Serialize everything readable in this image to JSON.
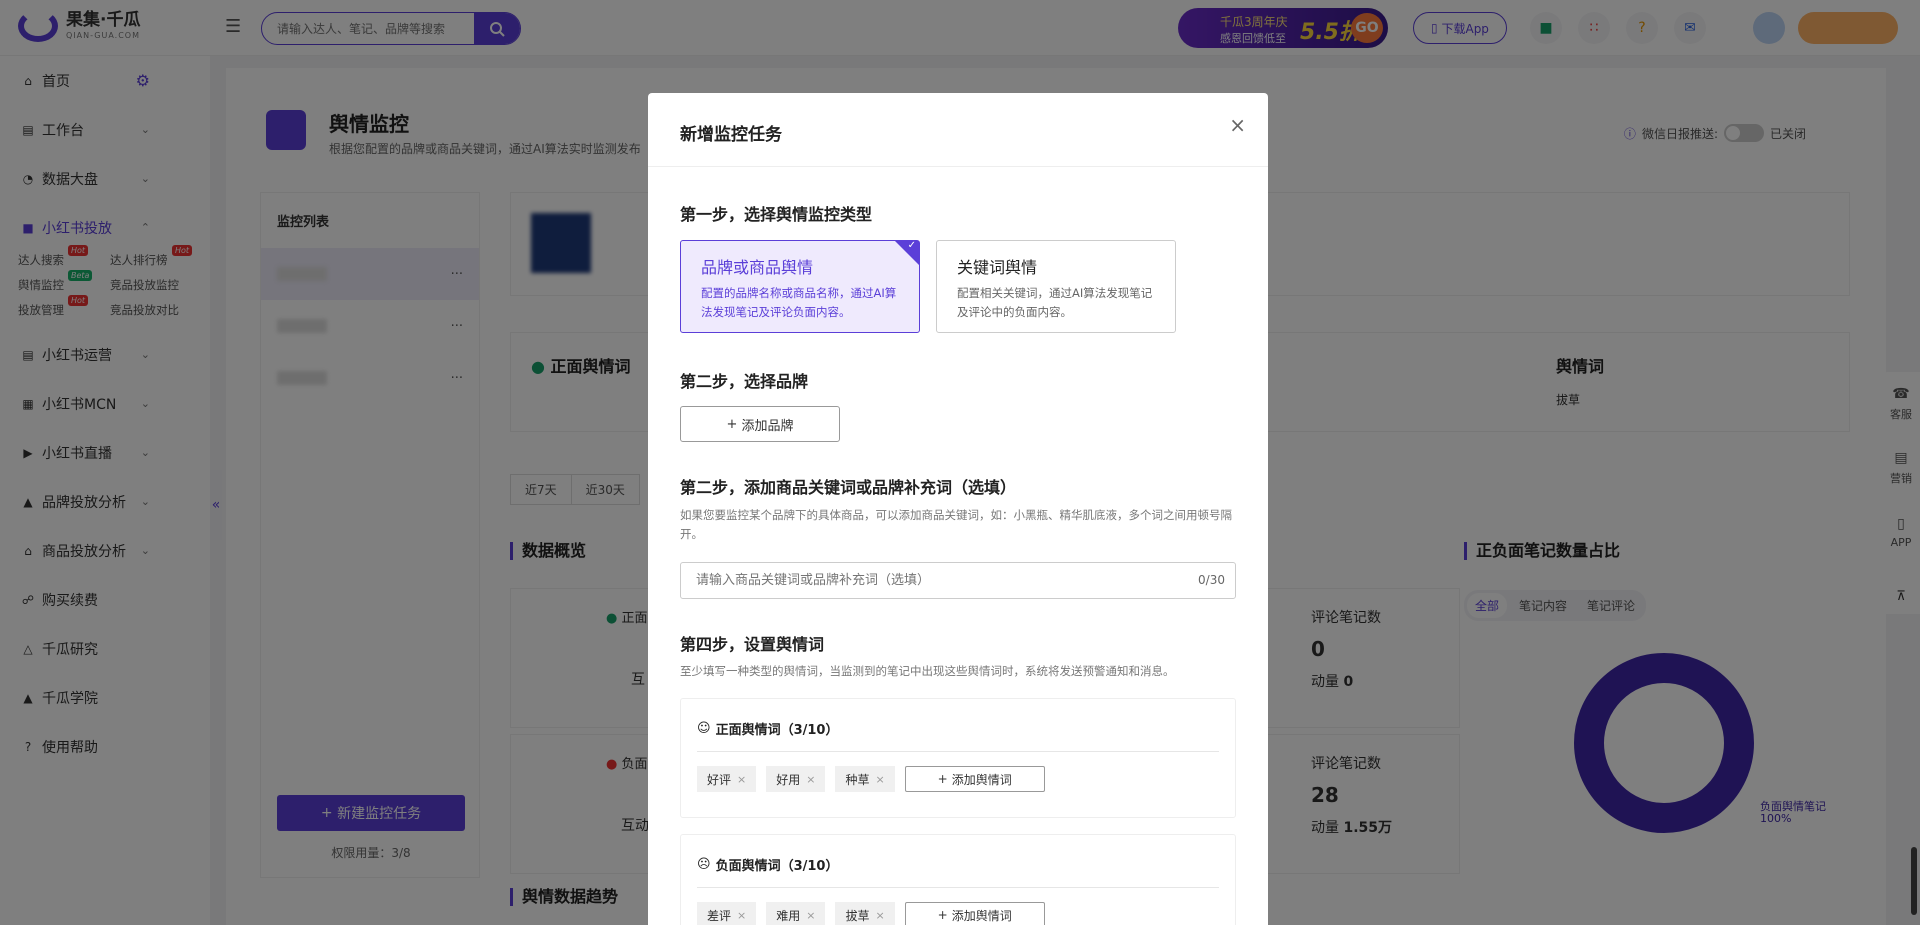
{
  "app": {
    "logo_name": "果集·千瓜",
    "logo_sub": "QIAN-GUA.COM"
  },
  "search": {
    "placeholder": "请输入达人、笔记、品牌等搜索"
  },
  "promo": {
    "line1": "千瓜3周年庆",
    "line2": "感恩回馈低至",
    "price": "5.5折",
    "go": "GO"
  },
  "header": {
    "download": "下载App"
  },
  "sidebar": {
    "items": [
      {
        "label": "首页"
      },
      {
        "label": "工作台"
      },
      {
        "label": "数据大盘"
      },
      {
        "label": "小红书投放"
      }
    ],
    "sub": [
      {
        "label": "达人搜索",
        "badge": "Hot"
      },
      {
        "label": "达人排行榜",
        "badge": "Hot"
      },
      {
        "label": "舆情监控",
        "badge": "Beta"
      },
      {
        "label": "竞品投放监控",
        "badge": ""
      },
      {
        "label": "投放管理",
        "badge": "Hot"
      },
      {
        "label": "竞品投放对比",
        "badge": ""
      }
    ],
    "items2": [
      {
        "label": "小红书运营"
      },
      {
        "label": "小红书MCN"
      },
      {
        "label": "小红书直播"
      },
      {
        "label": "品牌投放分析"
      },
      {
        "label": "商品投放分析"
      },
      {
        "label": "购买续费"
      },
      {
        "label": "千瓜研究"
      },
      {
        "label": "千瓜学院"
      },
      {
        "label": "使用帮助"
      }
    ]
  },
  "page": {
    "title": "舆情监控",
    "desc": "根据您配置的品牌或商品关键词，通过AI算法实时监测发布",
    "wechat_label": "微信日报推送:",
    "wechat_state": "已关闭",
    "list_title": "监控列表",
    "new_task": "新建监控任务",
    "quota": "权限用量：3/8",
    "pos_title": "正面舆情词",
    "neg_title": "舆情词",
    "neg_tag": "拔草",
    "tabs": [
      "近7天",
      "近30天"
    ],
    "overview": "数据概览",
    "trend": "舆情数据趋势",
    "ratio": "正负面笔记数量占比",
    "ratio_tabs": [
      "全部",
      "笔记内容",
      "笔记评论"
    ],
    "pos_short": "正面",
    "neg_short": "负面",
    "interact1": "互",
    "interact2": "互动",
    "notes_label1": "评论笔记数",
    "notes_val1": "0",
    "notes_sub1": "动量",
    "notes_sub1_val": "0",
    "notes_label2": "评论笔记数",
    "notes_val2": "28",
    "notes_sub2": "动量",
    "notes_sub2_val": "1.55万",
    "donut_label": "负面舆情笔记",
    "donut_pct": "100%"
  },
  "rightbar": {
    "items": [
      "客服",
      "营销",
      "APP"
    ]
  },
  "modal": {
    "title": "新增监控任务",
    "step1": "第一步，选择舆情监控类型",
    "type1_title": "品牌或商品舆情",
    "type1_desc": "配置的品牌名称或商品名称，通过AI算法发现笔记及评论负面内容。",
    "type2_title": "关键词舆情",
    "type2_desc": "配置相关关键词，通过AI算法发现笔记及评论中的负面内容。",
    "step2": "第二步，选择品牌",
    "add_brand": "添加品牌",
    "step3": "第二步，添加商品关键词或品牌补充词（选填）",
    "step3_note": "如果您要监控某个品牌下的具体商品，可以添加商品关键词，如：小黑瓶、精华肌底液，多个词之间用顿号隔开。",
    "kw_placeholder": "请输入商品关键词或品牌补充词（选填）",
    "kw_count": "0/30",
    "step4": "第四步，设置舆情词",
    "step4_note": "至少填写一种类型的舆情词，当监测到的笔记中出现这些舆情词时，系统将发送预警通知和消息。",
    "pos_head": "正面舆情词（3/10）",
    "pos_tags": [
      "好评",
      "好用",
      "种草"
    ],
    "neg_head": "负面舆情词（3/10）",
    "neg_tags": [
      "差评",
      "难用",
      "拔草"
    ],
    "add_kw": "添加舆情词"
  }
}
